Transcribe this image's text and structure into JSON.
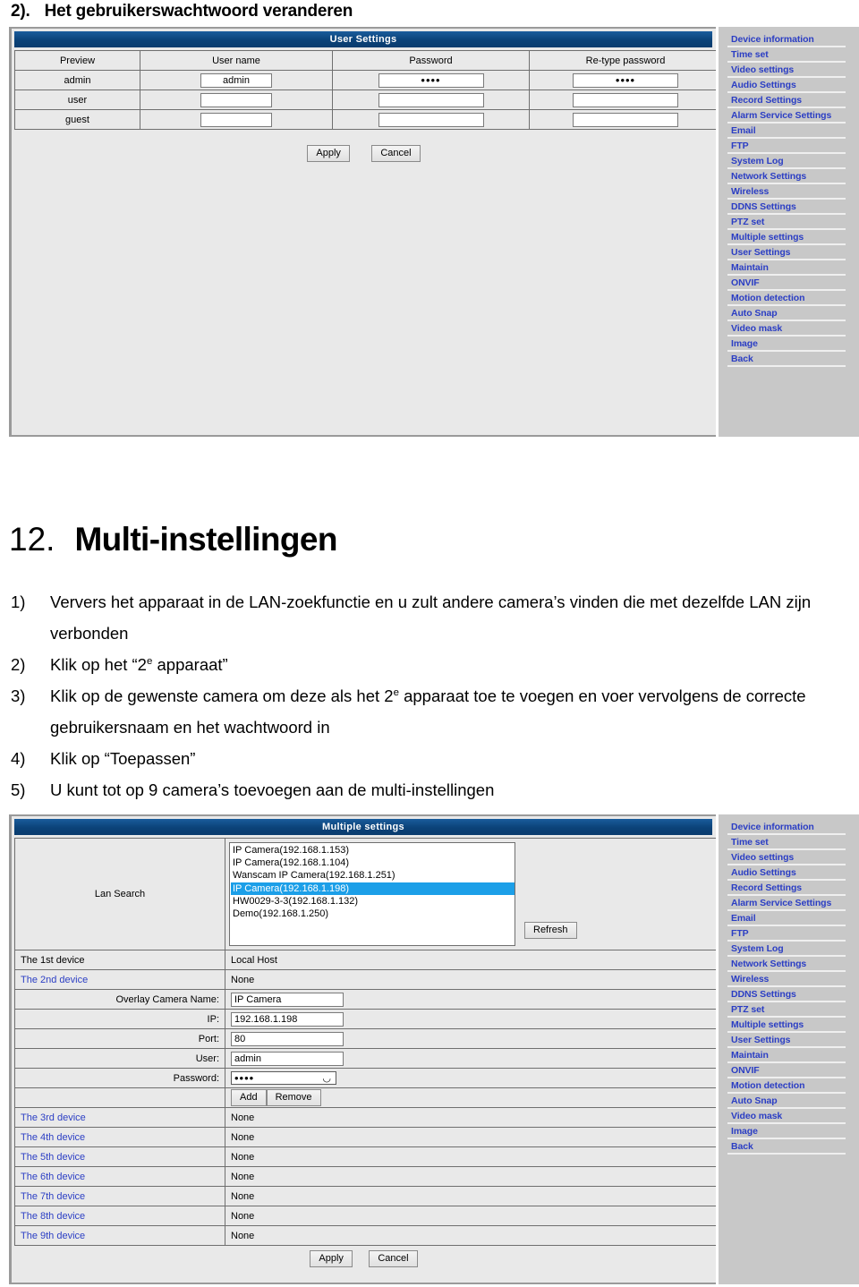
{
  "doc": {
    "section2": {
      "number": "2).",
      "title": "Het gebruikerswachtwoord veranderen"
    },
    "section12": {
      "number": "12.",
      "title": "Multi-instellingen"
    },
    "steps": [
      {
        "marker": "1)",
        "text_before": "Ververs het apparaat in de LAN-zoekfunctie en u zult andere camera’s vinden die met dezelfde LAN zijn verbonden",
        "sup": "",
        "text_after": ""
      },
      {
        "marker": "2)",
        "text_before": "Klik op het “2",
        "sup": "e",
        "text_after": " apparaat”"
      },
      {
        "marker": "3)",
        "text_before": "Klik op de gewenste camera om deze als het 2",
        "sup": "e",
        "text_after": " apparaat toe te voegen en voer vervolgens de correcte gebruikersnaam en het wachtwoord in"
      },
      {
        "marker": "4)",
        "text_before": "Klik op “Toepassen”",
        "sup": "",
        "text_after": ""
      },
      {
        "marker": "5)",
        "text_before": "U kunt tot op 9 camera’s toevoegen aan de multi-instellingen",
        "sup": "",
        "text_after": ""
      }
    ]
  },
  "colors": {
    "panel_header_blue": "#0d477f",
    "menu_link_blue": "#2b3ec4",
    "selection_blue": "#1c9fe8",
    "panel_bg": "#e9e9e9",
    "sidebar_bg": "#c8c8c8"
  },
  "camera_menu": [
    {
      "label": "Device information"
    },
    {
      "label": "Time set"
    },
    {
      "label": "Video settings"
    },
    {
      "label": "Audio Settings"
    },
    {
      "label": "Record Settings"
    },
    {
      "label": "Alarm Service Settings"
    },
    {
      "label": "Email"
    },
    {
      "label": "FTP"
    },
    {
      "label": "System Log"
    },
    {
      "label": "Network Settings"
    },
    {
      "label": "Wireless"
    },
    {
      "label": "DDNS Settings"
    },
    {
      "label": "PTZ set"
    },
    {
      "label": "Multiple settings"
    },
    {
      "label": "User Settings"
    },
    {
      "label": "Maintain"
    },
    {
      "label": "ONVIF"
    },
    {
      "label": "Motion detection"
    },
    {
      "label": "Auto Snap"
    },
    {
      "label": "Video mask"
    },
    {
      "label": "Image"
    },
    {
      "label": "Back"
    }
  ],
  "user_settings": {
    "title": "User Settings",
    "columns": [
      "Preview",
      "User name",
      "Password",
      "Re-type password"
    ],
    "rows": [
      {
        "preview": "admin",
        "username": "admin",
        "password": "••••",
        "retype": "••••"
      },
      {
        "preview": "user",
        "username": "",
        "password": "",
        "retype": ""
      },
      {
        "preview": "guest",
        "username": "",
        "password": "",
        "retype": ""
      }
    ],
    "apply_label": "Apply",
    "cancel_label": "Cancel"
  },
  "multiple_settings": {
    "title": "Multiple settings",
    "lan_search_label": "Lan Search",
    "lan_devices": [
      {
        "label": "IP Camera(192.168.1.153)",
        "selected": false
      },
      {
        "label": "IP Camera(192.168.1.104)",
        "selected": false
      },
      {
        "label": "Wanscam IP Camera(192.168.1.251)",
        "selected": false
      },
      {
        "label": "IP Camera(192.168.1.198)",
        "selected": true
      },
      {
        "label": "HW0029-3-3(192.168.1.132)",
        "selected": false
      },
      {
        "label": "Demo(192.168.1.250)",
        "selected": false
      }
    ],
    "refresh_label": "Refresh",
    "device_1": {
      "label": "The 1st device",
      "value": "Local Host"
    },
    "device_2": {
      "label": "The 2nd device",
      "value": "None"
    },
    "form": {
      "overlay_name_label": "Overlay Camera Name:",
      "overlay_name_value": "IP Camera",
      "ip_label": "IP:",
      "ip_value": "192.168.1.198",
      "port_label": "Port:",
      "port_value": "80",
      "user_label": "User:",
      "user_value": "admin",
      "password_label": "Password:",
      "password_value": "••••",
      "add_label": "Add",
      "remove_label": "Remove"
    },
    "other_devices": [
      {
        "label": "The 3rd device",
        "value": "None"
      },
      {
        "label": "The 4th device",
        "value": "None"
      },
      {
        "label": "The 5th device",
        "value": "None"
      },
      {
        "label": "The 6th device",
        "value": "None"
      },
      {
        "label": "The 7th device",
        "value": "None"
      },
      {
        "label": "The 8th device",
        "value": "None"
      },
      {
        "label": "The 9th device",
        "value": "None"
      }
    ],
    "apply_label": "Apply",
    "cancel_label": "Cancel"
  }
}
